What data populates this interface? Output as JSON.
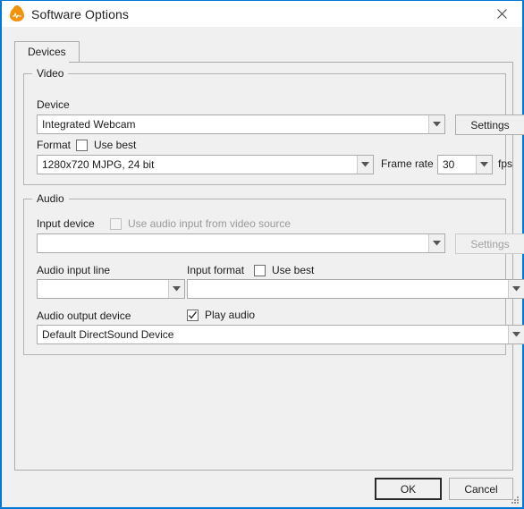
{
  "window": {
    "title": "Software Options",
    "icon": "flame-waveform-icon",
    "close_icon": "close-icon",
    "accent_color": "#0078d7",
    "background_color": "#f0f0f0"
  },
  "tabs": [
    {
      "label": "Devices",
      "selected": true
    }
  ],
  "video_group": {
    "title": "Video",
    "device_label": "Device",
    "device_value": "Integrated Webcam",
    "settings_label": "Settings",
    "format_label": "Format",
    "use_best_label": "Use best",
    "use_best_checked": false,
    "format_value": "1280x720 MJPG, 24 bit",
    "frame_rate_label": "Frame rate",
    "frame_rate_value": "30",
    "fps_label": "fps"
  },
  "audio_group": {
    "title": "Audio",
    "input_device_label": "Input device",
    "use_audio_from_video_label": "Use audio input from video source",
    "use_audio_from_video_checked": false,
    "use_audio_from_video_enabled": false,
    "input_device_value": "",
    "settings_label": "Settings",
    "settings_enabled": false,
    "audio_input_line_label": "Audio input line",
    "audio_input_line_value": "",
    "input_format_label": "Input format",
    "input_format_use_best_label": "Use best",
    "input_format_use_best_checked": false,
    "input_format_value": "",
    "audio_output_device_label": "Audio output device",
    "play_audio_label": "Play audio",
    "play_audio_checked": true,
    "audio_output_device_value": "Default DirectSound Device"
  },
  "footer": {
    "ok_label": "OK",
    "cancel_label": "Cancel"
  }
}
